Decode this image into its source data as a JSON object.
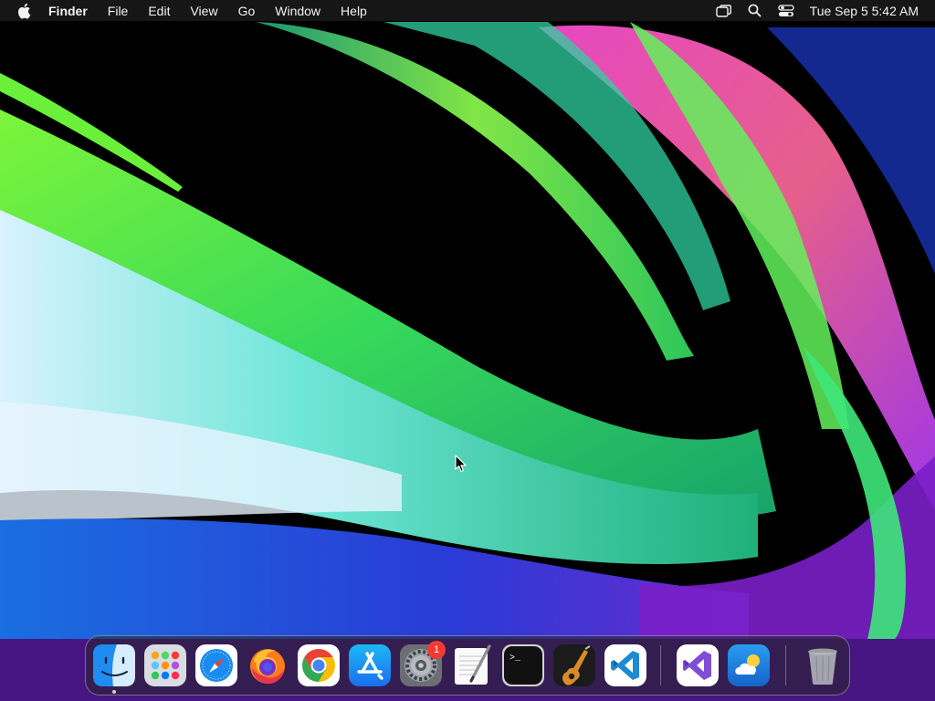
{
  "menubar": {
    "app_name": "Finder",
    "items": [
      "File",
      "Edit",
      "View",
      "Go",
      "Window",
      "Help"
    ],
    "status_icons": [
      "screen-mirroring-icon",
      "spotlight-search-icon",
      "control-center-icon"
    ],
    "clock": "Tue Sep 5  5:42 AM"
  },
  "dock": {
    "apps": [
      {
        "name": "Finder",
        "icon": "finder-icon",
        "running": true
      },
      {
        "name": "Launchpad",
        "icon": "launchpad-icon"
      },
      {
        "name": "Safari",
        "icon": "safari-icon"
      },
      {
        "name": "Firefox",
        "icon": "firefox-icon"
      },
      {
        "name": "Google Chrome",
        "icon": "chrome-icon"
      },
      {
        "name": "App Store",
        "icon": "app-store-icon"
      },
      {
        "name": "System Settings",
        "icon": "system-settings-icon",
        "badge": "1"
      },
      {
        "name": "TextEdit",
        "icon": "textedit-icon"
      },
      {
        "name": "Terminal",
        "icon": "terminal-icon"
      },
      {
        "name": "GarageBand",
        "icon": "garageband-icon"
      },
      {
        "name": "Visual Studio Code",
        "icon": "vscode-icon"
      },
      {
        "name": "Visual Studio",
        "icon": "visual-studio-icon"
      },
      {
        "name": "Weather",
        "icon": "weather-icon"
      },
      {
        "name": "Trash",
        "icon": "trash-icon"
      }
    ],
    "system_settings_badge": "1"
  },
  "colors": {
    "menubar_bg": "#161616",
    "badge_red": "#f23a35",
    "wallpaper_green": "#3ee84a",
    "wallpaper_cyan": "#39d6c9",
    "wallpaper_magenta": "#ff3fb6"
  }
}
